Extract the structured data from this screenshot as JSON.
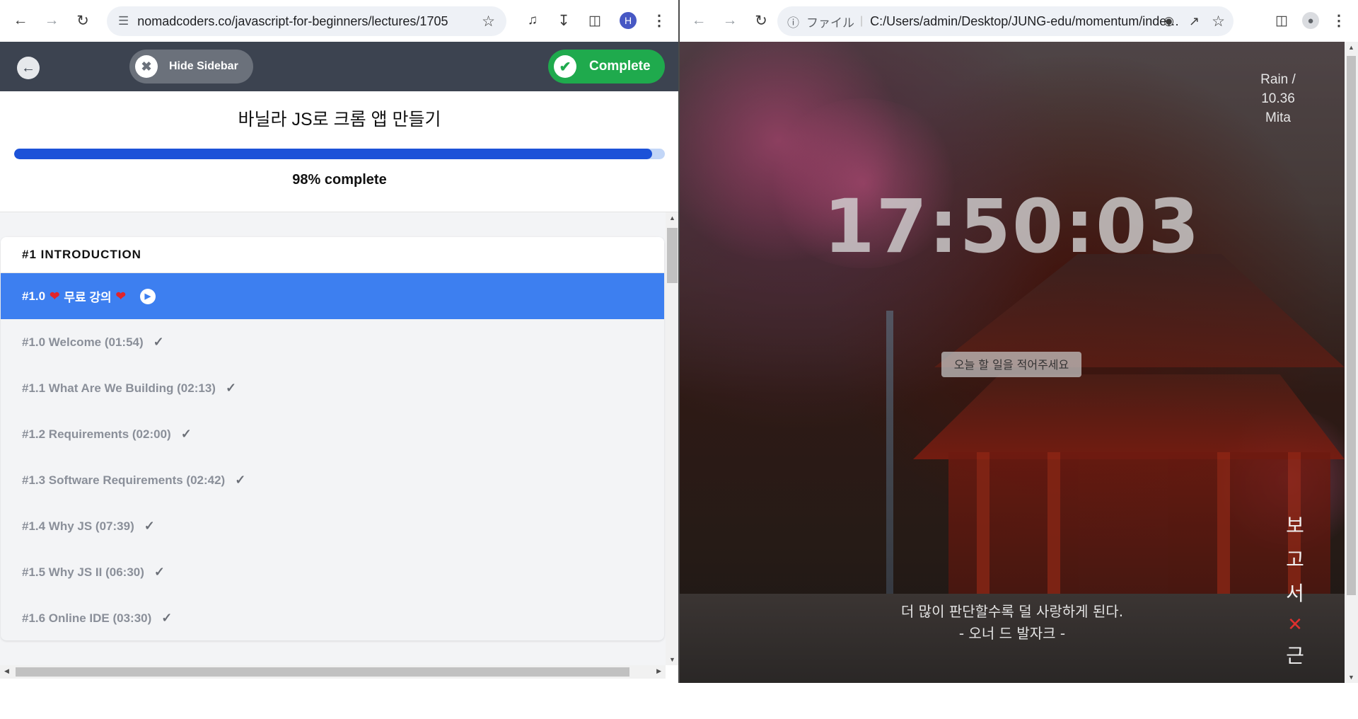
{
  "left_browser": {
    "url": "nomadcoders.co/javascript-for-beginners/lectures/1705",
    "profile_initial": "H"
  },
  "course": {
    "back_label": "",
    "hide_sidebar_label": "Hide Sidebar",
    "complete_label": "Complete",
    "title": "바닐라 JS로 크롬 앱 만들기",
    "progress_percent": 98,
    "progress_text": "98% complete",
    "section_title": "#1 INTRODUCTION",
    "active_lesson": {
      "prefix": "#1.0",
      "label": "무료 강의"
    },
    "lessons": [
      {
        "label": "#1.0 Welcome (01:54)"
      },
      {
        "label": "#1.1 What Are We Building (02:13)"
      },
      {
        "label": "#1.2 Requirements (02:00)"
      },
      {
        "label": "#1.3 Software Requirements (02:42)"
      },
      {
        "label": "#1.4 Why JS (07:39)"
      },
      {
        "label": "#1.5 Why JS II (06:30)"
      },
      {
        "label": "#1.6 Online IDE (03:30)"
      }
    ]
  },
  "right_browser": {
    "security_label": "ファイル",
    "url": "C:/Users/admin/Desktop/JUNG-edu/momentum/index.h..."
  },
  "momentum": {
    "weather": {
      "condition": "Rain /",
      "temp": "10.36",
      "city": "Mita"
    },
    "clock": "17:50:03",
    "todo_placeholder": "오늘 할 일을 적어주세요",
    "todos": [
      "보",
      "고",
      "서",
      "근"
    ],
    "delete_symbol": "✕",
    "quote": "더 많이 판단할수록 덜 사랑하게 된다.",
    "author": "- 오너 드 발자크 -"
  }
}
